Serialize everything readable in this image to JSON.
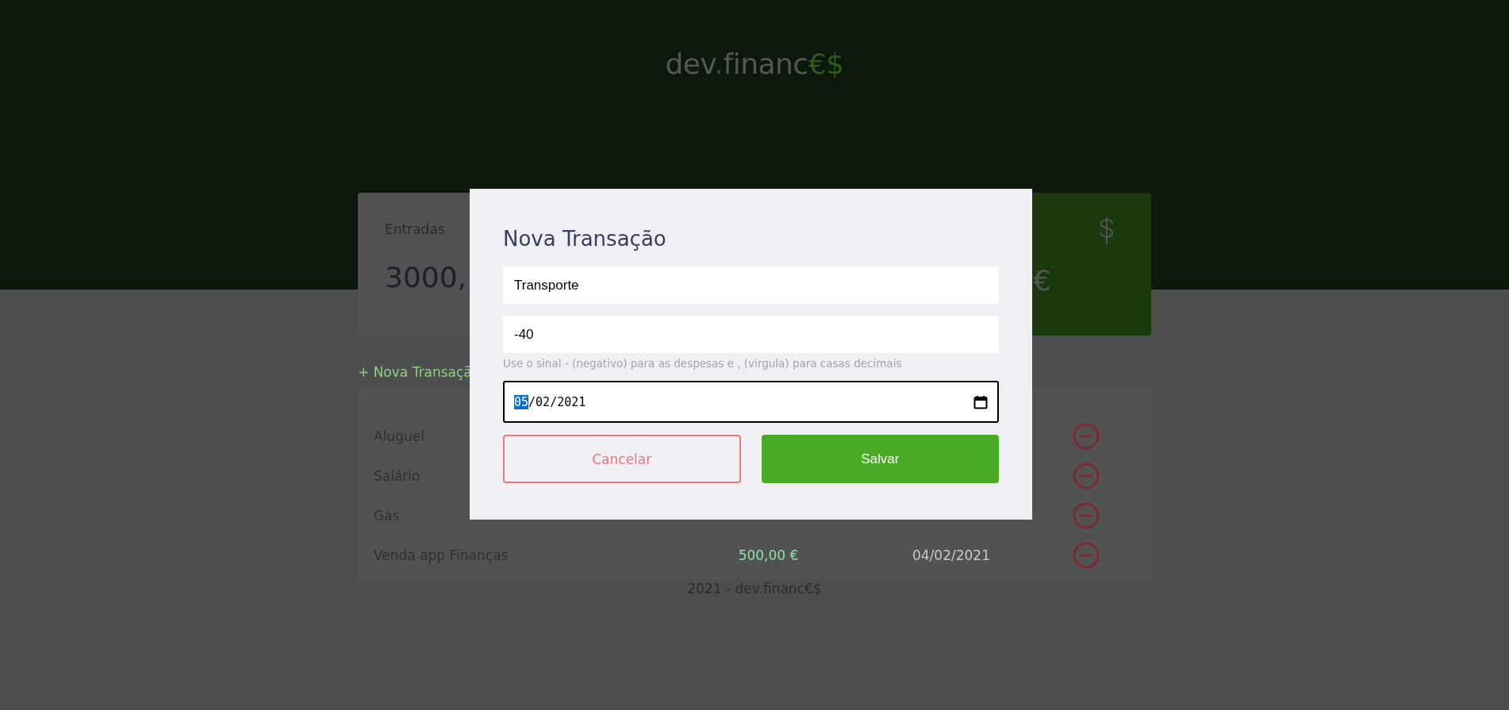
{
  "header": {
    "logo": {
      "main": "dev",
      "dot": ".",
      "name": "financ",
      "suffix": "€$"
    }
  },
  "cards": [
    {
      "kind": "income",
      "label": "Entradas",
      "value": "3000,"
    },
    {
      "kind": "total",
      "value": "€"
    }
  ],
  "new_transaction_link": "+ Nova Transaçã",
  "transactions": [
    {
      "description": "Aluguel"
    },
    {
      "description": "Salário"
    },
    {
      "description": "Gás"
    },
    {
      "description": "Venda app Finanças",
      "amount": "500,00 €",
      "date": "04/02/2021"
    }
  ],
  "footer": "2021 - dev.financ€$",
  "modal": {
    "title": "Nova Transação",
    "description_field": {
      "value": "Transporte"
    },
    "amount_field": {
      "value": "-40"
    },
    "help": "Use o sinal - (negativo) para as despesas e , (virgula) para casas decimais",
    "date_field": {
      "segments": [
        {
          "text": "05",
          "selected": true
        },
        {
          "text": "/",
          "selected": false
        },
        {
          "text": "02",
          "selected": false
        },
        {
          "text": "/",
          "selected": false
        },
        {
          "text": "2021",
          "selected": false
        }
      ]
    },
    "buttons": [
      {
        "kind": "cancel",
        "label": "Cancelar"
      },
      {
        "kind": "save",
        "label": "Salvar"
      }
    ]
  }
}
